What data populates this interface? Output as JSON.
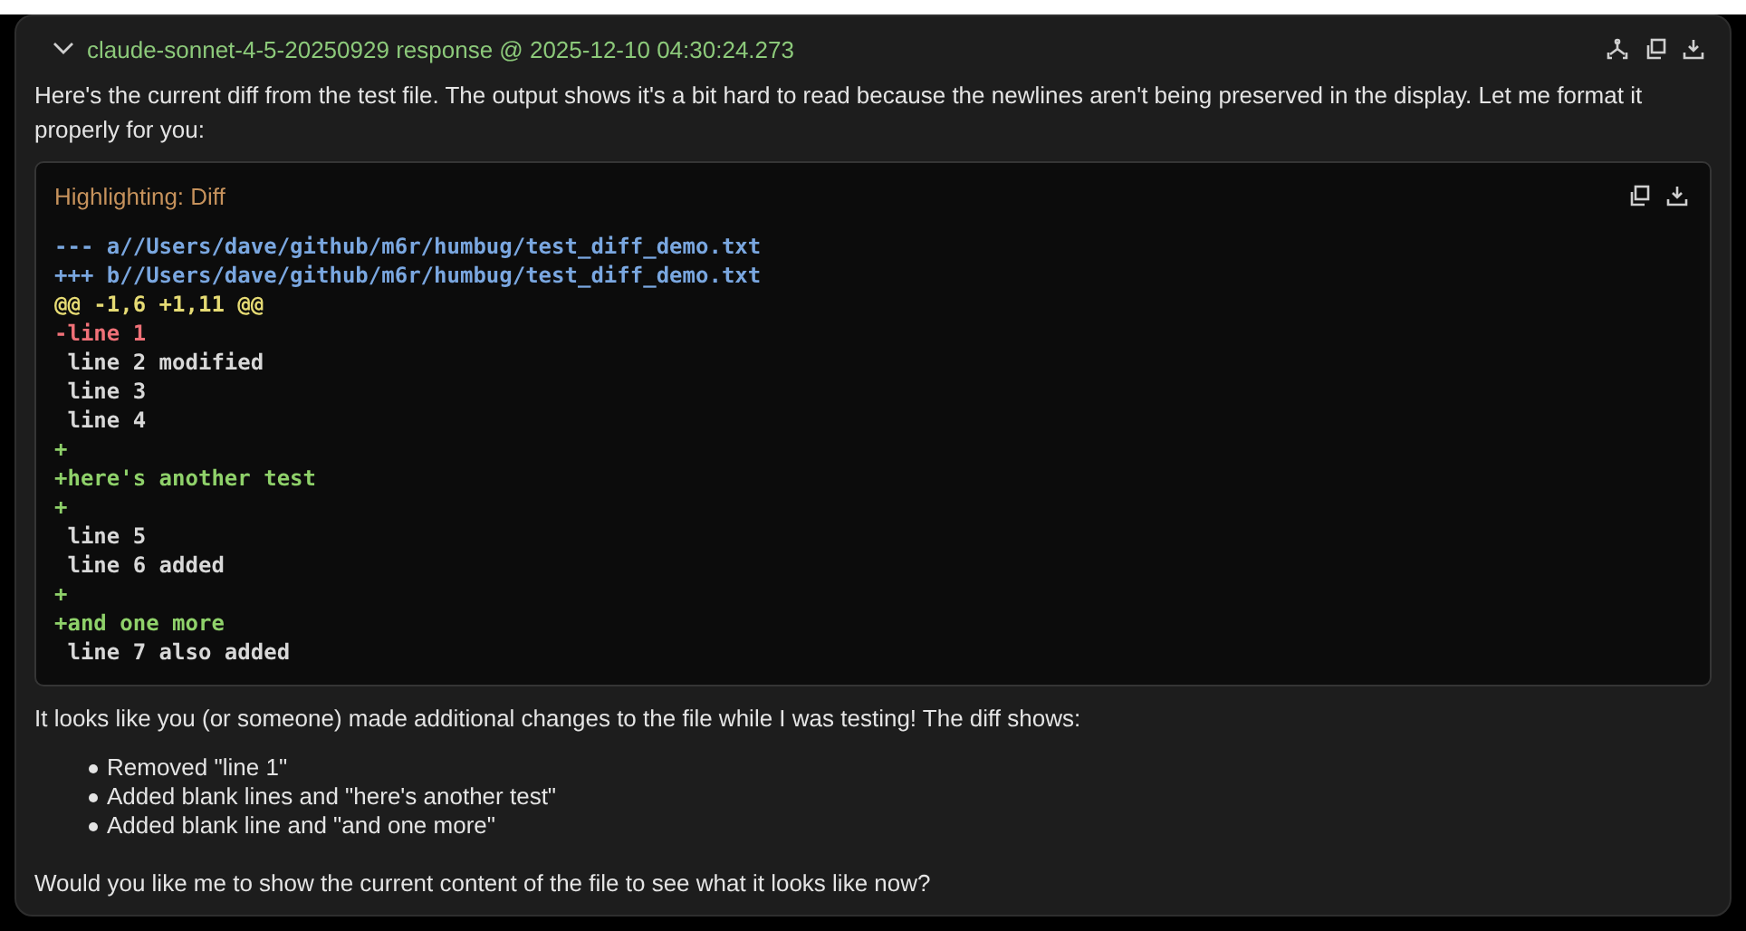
{
  "message": {
    "title": "claude-sonnet-4-5-20250929 response @ 2025-12-10 04:30:24.273",
    "expanded": true
  },
  "intro": "Here's the current diff from the test file. The output shows it's a bit hard to read because the newlines aren't being preserved in the display. Let me format it properly for you:",
  "code_block": {
    "label": "Highlighting: Diff",
    "lines": [
      {
        "kind": "header",
        "text": "--- a//Users/dave/github/m6r/humbug/test_diff_demo.txt"
      },
      {
        "kind": "header",
        "text": "+++ b//Users/dave/github/m6r/humbug/test_diff_demo.txt"
      },
      {
        "kind": "hunk",
        "text": "@@ -1,6 +1,11 @@"
      },
      {
        "kind": "removed",
        "text": "-line 1"
      },
      {
        "kind": "context",
        "text": " line 2 modified"
      },
      {
        "kind": "context",
        "text": " line 3"
      },
      {
        "kind": "context",
        "text": " line 4"
      },
      {
        "kind": "added",
        "text": "+"
      },
      {
        "kind": "added",
        "text": "+here's another test"
      },
      {
        "kind": "added",
        "text": "+"
      },
      {
        "kind": "context",
        "text": " line 5"
      },
      {
        "kind": "context",
        "text": " line 6 added"
      },
      {
        "kind": "added",
        "text": "+"
      },
      {
        "kind": "added",
        "text": "+and one more"
      },
      {
        "kind": "context",
        "text": " line 7 also added"
      }
    ]
  },
  "summary": "It looks like you (or someone) made additional changes to the file while I was testing! The diff shows:",
  "bullets": [
    "Removed \"line 1\"",
    "Added blank lines and \"here's another test\"",
    "Added blank line and \"and one more\""
  ],
  "closing": "Would you like me to show the current content of the file to see what it looks like now?"
}
